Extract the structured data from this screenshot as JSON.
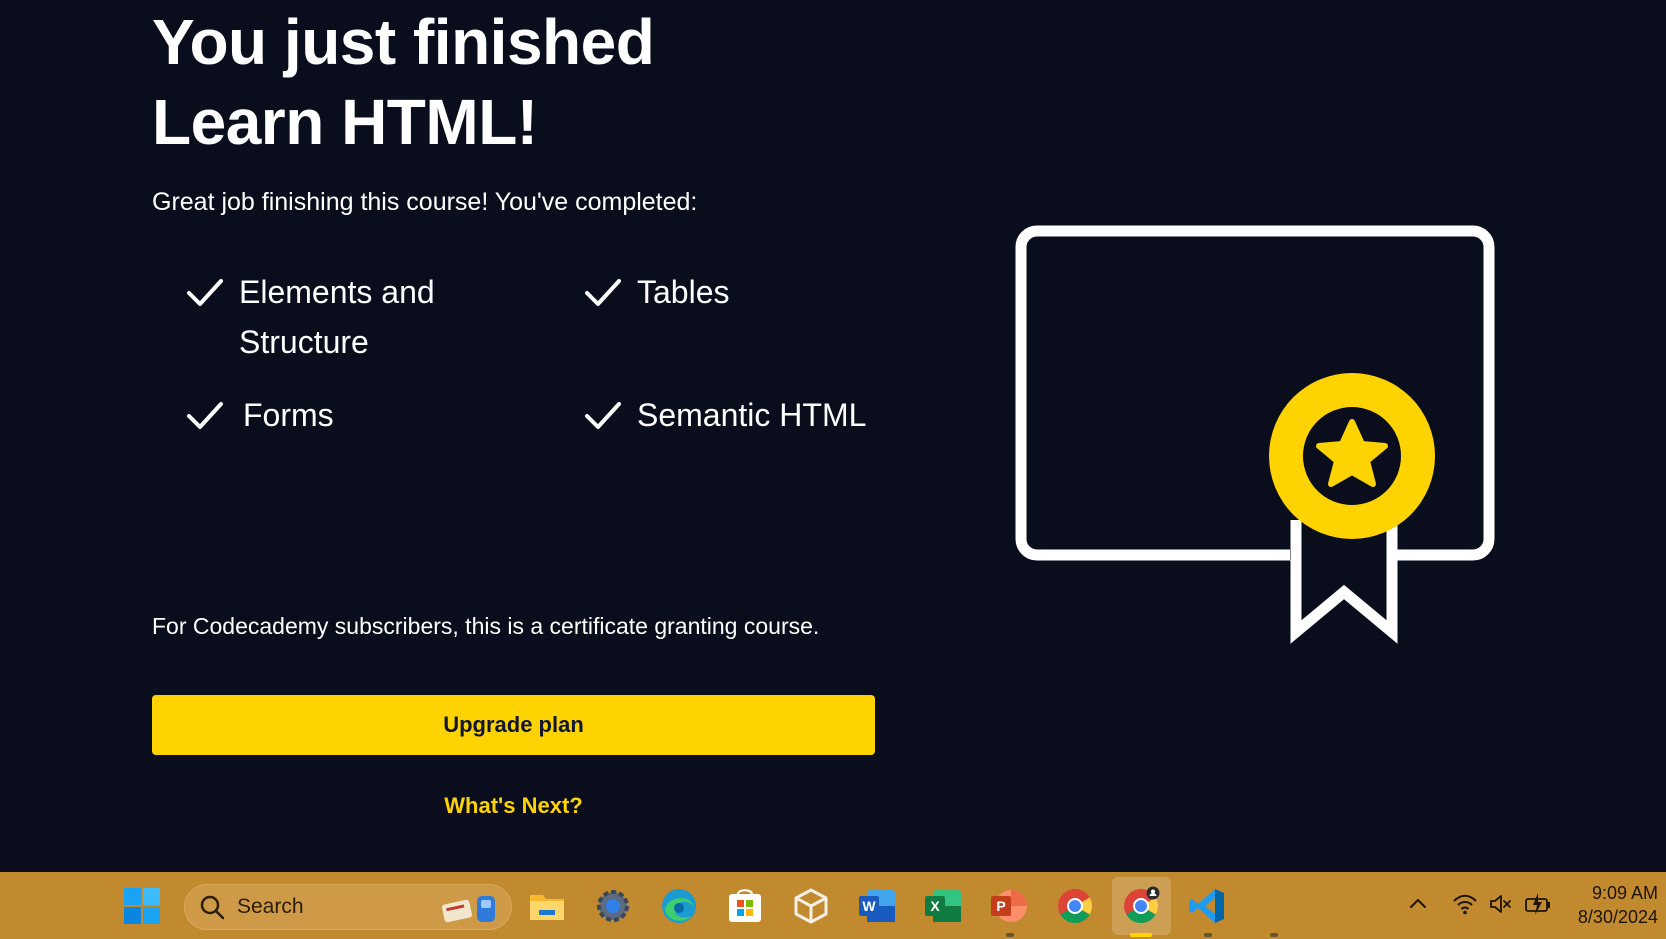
{
  "main": {
    "title_line1": "You just finished",
    "title_line2": "Learn HTML!",
    "subtitle": "Great job finishing this course! You've completed:",
    "completed": [
      {
        "line1": "Elements and",
        "line2": "Structure"
      },
      {
        "line1": "Tables"
      },
      {
        "line1": "Forms"
      },
      {
        "line1": "Semantic HTML"
      }
    ],
    "note": "For Codecademy subscribers, this is a certificate granting course.",
    "upgrade_label": "Upgrade plan",
    "whats_next_label": "What's Next?",
    "colors": {
      "background": "#0a0d1c",
      "accent": "#ffd300",
      "text": "#ffffff"
    },
    "illustration_icon": "certificate-icon"
  },
  "taskbar": {
    "search_placeholder": "Search",
    "apps": [
      "start-icon",
      "file-explorer-icon",
      "settings-icon",
      "edge-icon",
      "microsoft-store-icon",
      "package-icon",
      "word-icon",
      "excel-icon",
      "powerpoint-icon",
      "chrome-icon",
      "chrome-profile-icon",
      "vscode-icon"
    ],
    "clock_time": "9:09 AM",
    "clock_date": "8/30/2024",
    "colors": {
      "background": "#c18a2f"
    }
  }
}
